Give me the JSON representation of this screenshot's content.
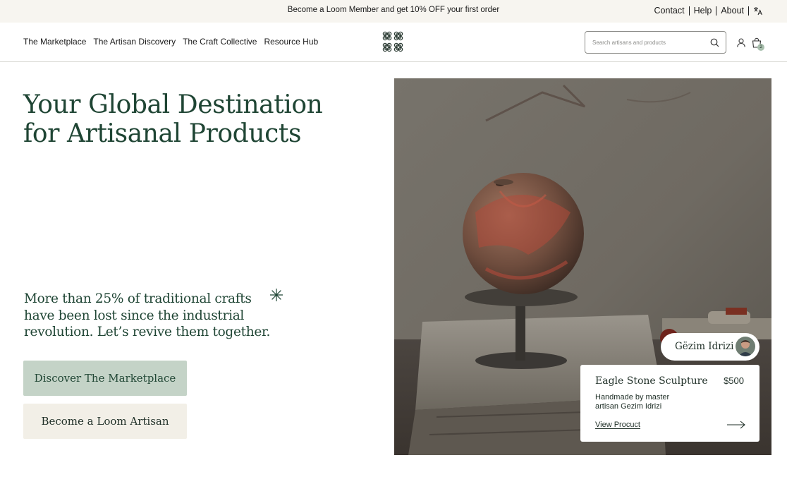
{
  "promo": {
    "text": "Become a Loom Member and get 10% OFF your first order"
  },
  "utility_nav": {
    "contact": "Contact",
    "help": "Help",
    "about": "About",
    "language_icon": "translate-icon"
  },
  "main_nav": {
    "items": [
      "The Marketplace",
      "The Artisan Discovery",
      "The Craft Collective",
      "Resource Hub"
    ]
  },
  "logo": {
    "icon": "loom-logo-icon"
  },
  "search": {
    "placeholder": "Search artisans and products",
    "icon": "search-icon"
  },
  "account": {
    "icon": "user-icon"
  },
  "cart": {
    "icon": "shopping-bag-icon",
    "count": "2"
  },
  "hero": {
    "title": "Your Global Destination for Artisanal Products",
    "subtitle": "More than 25% of traditional crafts have been lost since the industrial revolution. Let’s revive them together.",
    "primary_cta": "Discover The Marketplace",
    "secondary_cta": "Become a Loom Artisan"
  },
  "featured": {
    "artisan_name": "Gëzim Idrizi",
    "product_name": "Eagle Stone Sculpture",
    "price": "$500",
    "description": "Handmade by master artisan Gezim Idrizi",
    "link": "View Procuct"
  },
  "colors": {
    "brand_green": "#1f4534",
    "primary_button": "#c4d3c7",
    "secondary_button": "#f2efe7",
    "promo_bg": "#f7f5f0"
  }
}
